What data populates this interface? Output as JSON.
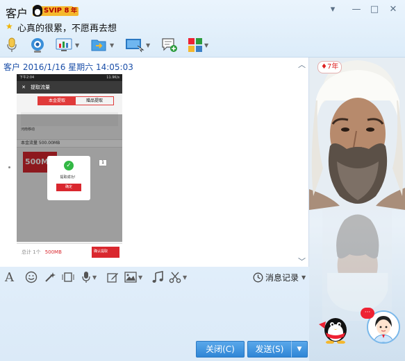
{
  "window": {
    "contact_name": "客户",
    "vip_label": "SVIP 8",
    "year_label": "年",
    "signature": "心真的很累，不愿再去想",
    "controls": {
      "menu": "▾",
      "minimize": "—",
      "maximize": "□",
      "close": "✕"
    }
  },
  "toolbar": {
    "items": [
      "microphone-icon",
      "video-icon",
      "share-screen-icon",
      "file-transfer-icon",
      "remote-desktop-icon",
      "create-chat-icon",
      "apps-icon"
    ]
  },
  "chat": {
    "message_header": "客户 2016/1/16 星期六 14:05:03",
    "shared_image": {
      "status_time": "下午2:04",
      "status_right": "11.9K/s",
      "app_title": "提取流量",
      "tab_active": "本金提取",
      "tab_inactive": "赠品提取",
      "carrier": "河南移动",
      "flow_label": "本金流量 500.00MB",
      "card_value": "500M",
      "modal_text": "提取成功！",
      "modal_button": "确定",
      "stepper_value": "1",
      "total_label": "总计 1个",
      "total_amount": "500MB",
      "confirm_button": "确认提取"
    }
  },
  "tools": {
    "history_label": "消息记录"
  },
  "buttons": {
    "close_label": "关闭(C)",
    "send_label": "发送(S)"
  },
  "sidebar": {
    "days_label": "7年"
  },
  "colors": {
    "accent": "#2f86d6",
    "timestamp": "#1a4ea8",
    "vip_gold": "#f5b82e",
    "red": "#d9272e"
  }
}
